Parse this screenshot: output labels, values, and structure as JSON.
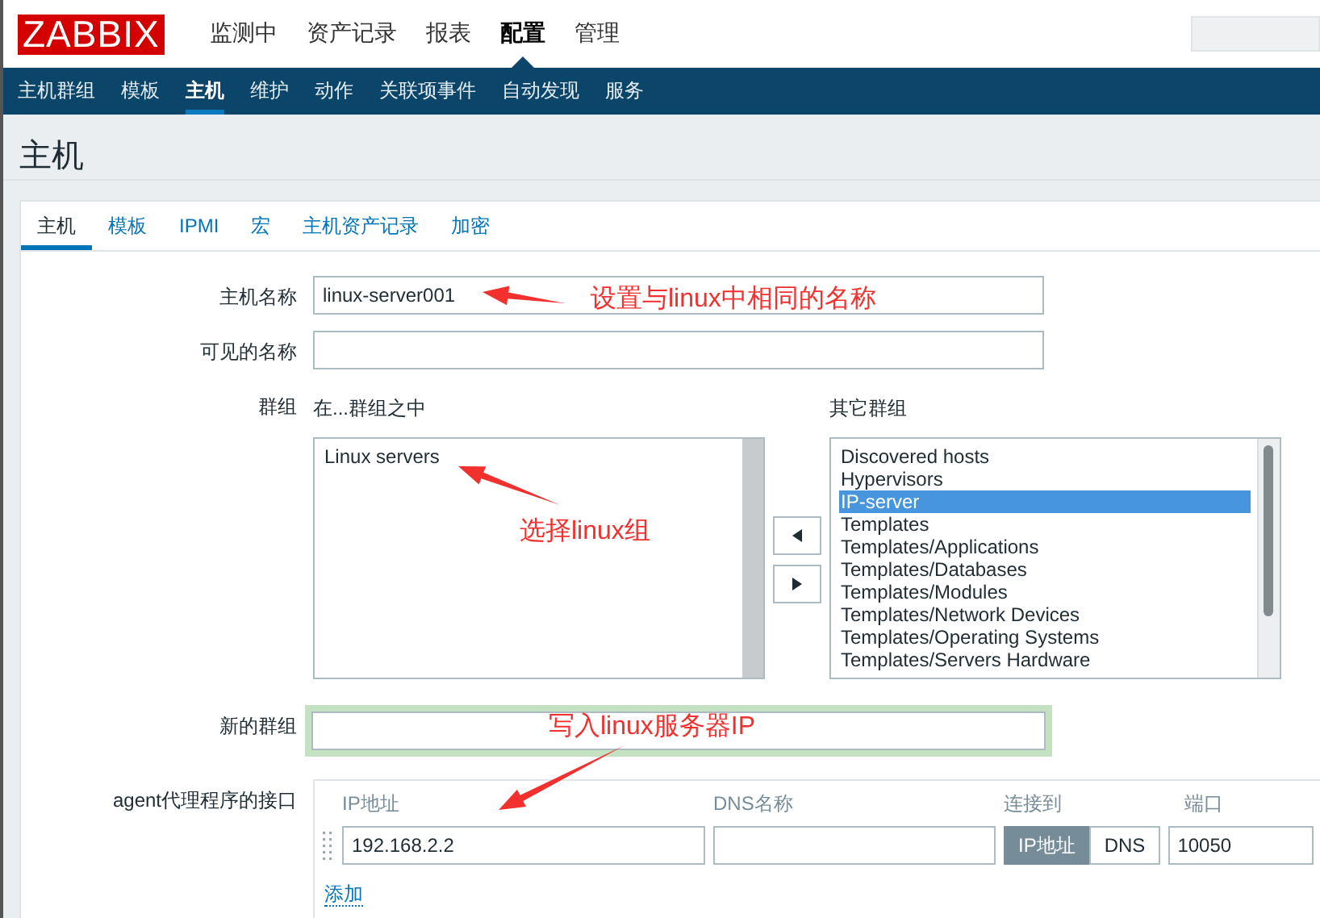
{
  "logo": "ZABBIX",
  "top_nav": [
    {
      "label": "监测中",
      "selected": false
    },
    {
      "label": "资产记录",
      "selected": false
    },
    {
      "label": "报表",
      "selected": false
    },
    {
      "label": "配置",
      "selected": true
    },
    {
      "label": "管理",
      "selected": false
    }
  ],
  "sub_nav": [
    {
      "label": "主机群组",
      "selected": false
    },
    {
      "label": "模板",
      "selected": false
    },
    {
      "label": "主机",
      "selected": true
    },
    {
      "label": "维护",
      "selected": false
    },
    {
      "label": "动作",
      "selected": false
    },
    {
      "label": "关联项事件",
      "selected": false
    },
    {
      "label": "自动发现",
      "selected": false
    },
    {
      "label": "服务",
      "selected": false
    }
  ],
  "page_title": "主机",
  "tabs": [
    {
      "label": "主机",
      "selected": true
    },
    {
      "label": "模板",
      "selected": false
    },
    {
      "label": "IPMI",
      "selected": false
    },
    {
      "label": "宏",
      "selected": false
    },
    {
      "label": "主机资产记录",
      "selected": false
    },
    {
      "label": "加密",
      "selected": false
    }
  ],
  "form": {
    "host_name": {
      "label": "主机名称",
      "value": "linux-server001"
    },
    "visible_name": {
      "label": "可见的名称"
    },
    "groups": {
      "label": "群组",
      "in_groups_title": "在...群组之中",
      "in_groups": [
        {
          "label": "Linux servers",
          "selected": false
        }
      ],
      "other_groups_title": "其它群组",
      "other_groups": [
        {
          "label": "Discovered hosts",
          "selected": false
        },
        {
          "label": "Hypervisors",
          "selected": false
        },
        {
          "label": "IP-server",
          "selected": true
        },
        {
          "label": "Templates",
          "selected": false
        },
        {
          "label": "Templates/Applications",
          "selected": false
        },
        {
          "label": "Templates/Databases",
          "selected": false
        },
        {
          "label": "Templates/Modules",
          "selected": false
        },
        {
          "label": "Templates/Network Devices",
          "selected": false
        },
        {
          "label": "Templates/Operating Systems",
          "selected": false
        },
        {
          "label": "Templates/Servers Hardware",
          "selected": false
        }
      ]
    },
    "new_group": {
      "label": "新的群组"
    },
    "interfaces": {
      "label": "agent代理程序的接口",
      "columns": [
        "IP地址",
        "DNS名称",
        "连接到",
        "端口"
      ],
      "ip": "192.168.2.2",
      "connect_to": [
        {
          "label": "IP地址",
          "selected": true
        },
        {
          "label": "DNS",
          "selected": false
        }
      ],
      "port": "10050",
      "add_link": "添加"
    }
  },
  "annotations": [
    {
      "text": "设置与linux中相同的名称"
    },
    {
      "text": "选择linux组"
    },
    {
      "text": "写入linux服务器IP"
    }
  ]
}
